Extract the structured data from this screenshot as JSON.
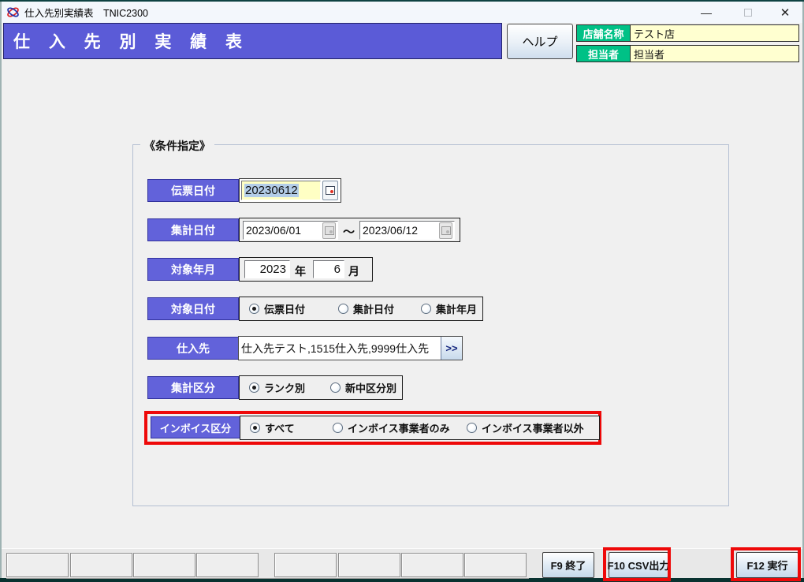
{
  "titlebar": {
    "title": "仕入先別実績表　TNIC2300",
    "minimize_glyph": "—",
    "close_glyph": "✕"
  },
  "header": {
    "title": "仕 入 先 別 実 績 表",
    "help_label": "ヘルプ"
  },
  "store_info": {
    "rows": [
      {
        "label": "店舗名称",
        "value": "テスト店"
      },
      {
        "label": "担当者",
        "value": "担当者"
      }
    ]
  },
  "conditions": {
    "group_title": "《条件指定》",
    "slip_date": {
      "label": "伝票日付",
      "value": "20230612"
    },
    "agg_date": {
      "label": "集計日付",
      "from": "2023/06/01",
      "separator": "～",
      "to": "2023/06/12"
    },
    "target_ym": {
      "label": "対象年月",
      "year": "2023",
      "year_unit": "年",
      "month": "6",
      "month_unit": "月"
    },
    "target_date": {
      "label": "対象日付",
      "options": [
        "伝票日付",
        "集計日付",
        "集計年月"
      ],
      "selected_index": 0
    },
    "supplier": {
      "label": "仕入先",
      "value": "仕入先テスト,1515仕入先,9999仕入先",
      "more_button": ">>"
    },
    "agg_division": {
      "label": "集計区分",
      "options": [
        "ランク別",
        "新中区分別"
      ],
      "selected_index": 0
    },
    "invoice_division": {
      "label": "インボイス区分",
      "options": [
        "すべて",
        "インボイス事業者のみ",
        "インボイス事業者以外"
      ],
      "selected_index": 0
    }
  },
  "footer": {
    "f9_label": "F9 終了",
    "f10_label": "F10 CSV出力",
    "f12_label": "F12 実行"
  },
  "colors": {
    "header_blue": "#5b5bd7",
    "field_label_blue": "#6262da",
    "info_label_green": "#00c186",
    "info_field_yellow": "#ffffd0",
    "date_input_yellow": "#ffffc4",
    "selection_blue": "#b3cde8",
    "highlight_red": "#ee0909"
  }
}
